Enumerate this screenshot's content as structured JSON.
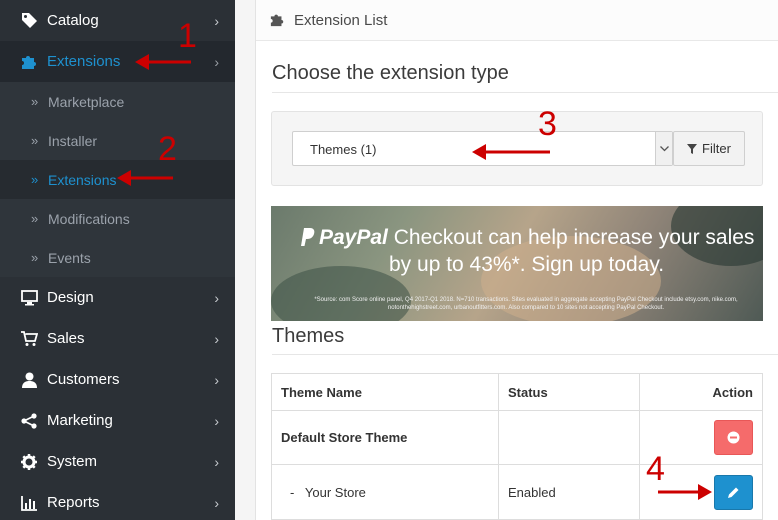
{
  "sidebar": {
    "items": [
      {
        "label": "Catalog",
        "icon": "tag-icon"
      },
      {
        "label": "Extensions",
        "icon": "puzzle-icon"
      },
      {
        "label": "Design",
        "icon": "monitor-icon"
      },
      {
        "label": "Sales",
        "icon": "cart-icon"
      },
      {
        "label": "Customers",
        "icon": "user-icon"
      },
      {
        "label": "Marketing",
        "icon": "share-icon"
      },
      {
        "label": "System",
        "icon": "gear-icon"
      },
      {
        "label": "Reports",
        "icon": "bar-chart-icon"
      }
    ],
    "sub_items": [
      {
        "label": "Marketplace"
      },
      {
        "label": "Installer"
      },
      {
        "label": "Extensions"
      },
      {
        "label": "Modifications"
      },
      {
        "label": "Events"
      }
    ],
    "chevron": "›",
    "sub_marker": "»"
  },
  "panel": {
    "title": "Extension List",
    "choose_heading": "Choose the extension type",
    "type_select_value": "Themes (1)",
    "filter_label": "Filter"
  },
  "banner": {
    "brand": "PayPal",
    "line1_rest": "Checkout can help increase your sales",
    "line2": "by up to 43%*. Sign up today.",
    "fine_print": "*Source: com Score online panel, Q4 2017-Q1 2018. N=710 transactions. Sites evaluated in aggregate accepting PayPal Checkout include etsy.com, nike.com, notonthehighstreet.com, urbanoutfitters.com. Also compared to 10 sites not accepting PayPal Checkout."
  },
  "themes": {
    "heading": "Themes",
    "columns": [
      "Theme Name",
      "Status",
      "Action"
    ],
    "rows": [
      {
        "name": "Default Store Theme",
        "status": "",
        "action": "delete"
      },
      {
        "name": "-   Your Store",
        "status": "Enabled",
        "action": "edit"
      }
    ]
  },
  "annotations": {
    "numbers": [
      "1",
      "2",
      "3",
      "4"
    ],
    "color": "#cc0000"
  },
  "colors": {
    "sidebar_bg": "#2b3036",
    "active_blue": "#1e91cf",
    "danger": "#f56b6b"
  }
}
